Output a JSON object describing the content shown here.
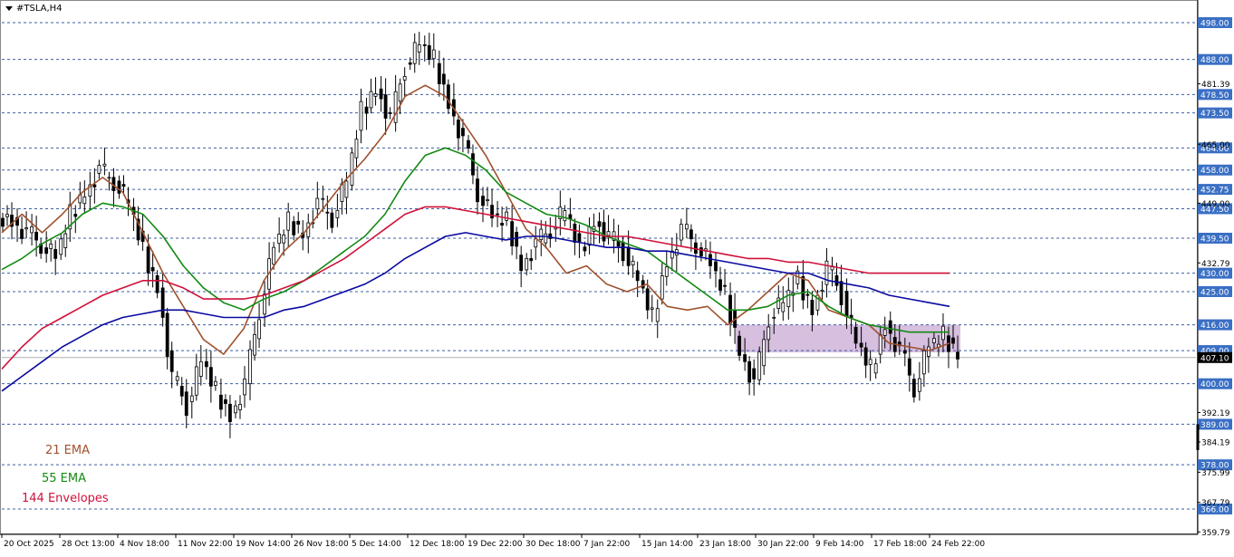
{
  "symbol": "#TSLA,H4",
  "legend": [
    {
      "label": "21 EMA",
      "color": "#a0522d"
    },
    {
      "label": "55 EMA",
      "color": "#138a13"
    },
    {
      "label": "144 Envelopes",
      "color": "#d0103a"
    }
  ],
  "colors": {
    "grid_level": "#3a5fa6",
    "price_badge": "#3a6fc4",
    "ema21": "#a0522d",
    "ema55": "#138a13",
    "env_upper": "#d0103a",
    "env_lower": "#0a0aa0",
    "zone": "#c9a9d4",
    "candle": "#000000",
    "current_price_badge": "#000000"
  },
  "chart_data": {
    "type": "candlestick",
    "symbol": "#TSLA",
    "timeframe": "H4",
    "ylim": [
      359.79,
      502
    ],
    "x_tick_labels": [
      "20 Oct 2025",
      "28 Oct 13:00",
      "4 Nov 18:00",
      "11 Nov 22:00",
      "19 Nov 14:00",
      "26 Nov 18:00",
      "5 Dec 14:00",
      "12 Dec 18:00",
      "19 Dec 22:00",
      "30 Dec 18:00",
      "7 Jan 22:00",
      "15 Jan 14:00",
      "23 Jan 18:00",
      "30 Jan 22:00",
      "9 Feb 14:00",
      "17 Feb 18:00",
      "24 Feb 22:00"
    ],
    "y_tick_labels": [
      481.39,
      465.0,
      449.0,
      432.79,
      392.19,
      384.19,
      375.99,
      367.79,
      359.79
    ],
    "horizontal_levels": [
      498.0,
      488.0,
      478.5,
      473.5,
      464.0,
      458.0,
      452.75,
      447.5,
      439.5,
      430.0,
      425.0,
      416.0,
      409.0,
      400.0,
      389.0,
      378.0,
      366.0
    ],
    "level_labels": [
      "498.00",
      "488.00",
      "478.50",
      "473.50",
      "464.00",
      "458.00",
      "452.75",
      "447.50",
      "439.50",
      "430.00",
      "425.00",
      "416.00",
      "409.00",
      "400.00",
      "389.00",
      "378.00",
      "366.00"
    ],
    "current_price": 407.1,
    "current_price_label": "407.10",
    "zone": {
      "from": 408.5,
      "to": 416.0,
      "start_date": "23 Jan 18:00",
      "end_date": "24 Feb 22:00"
    },
    "series": [
      {
        "name": "21 EMA",
        "values": [
          441,
          446,
          441,
          446,
          452,
          456,
          452,
          441,
          430,
          421,
          412,
          408,
          415,
          428,
          436,
          441,
          448,
          455,
          461,
          468,
          478,
          481,
          478,
          470,
          462,
          452,
          442,
          437,
          430,
          432,
          427,
          425,
          427,
          421,
          420,
          421,
          416,
          420,
          425,
          430,
          428,
          420,
          418,
          416,
          411,
          410,
          409,
          411
        ]
      },
      {
        "name": "55 EMA",
        "values": [
          431,
          434,
          438,
          441,
          446,
          449,
          448,
          446,
          440,
          432,
          426,
          422,
          420,
          423,
          425,
          428,
          432,
          436,
          440,
          446,
          455,
          462,
          464,
          462,
          458,
          452,
          449,
          446,
          445,
          443,
          440,
          438,
          436,
          432,
          428,
          424,
          420,
          420,
          421,
          424,
          425,
          421,
          418,
          416,
          415,
          414,
          414,
          414
        ]
      },
      {
        "name": "144 Envelopes upper",
        "values": [
          404,
          410,
          415,
          418,
          421,
          424,
          426,
          428,
          428,
          426,
          423,
          423,
          423,
          424,
          426,
          428,
          431,
          434,
          438,
          442,
          446,
          448,
          448,
          447,
          446,
          445,
          444,
          443,
          442,
          441,
          440,
          440,
          439,
          438,
          437,
          436,
          435,
          434,
          434,
          433,
          433,
          432,
          431,
          430,
          430,
          430,
          430,
          430
        ]
      },
      {
        "name": "144 Envelopes lower",
        "values": [
          398,
          402,
          406,
          410,
          413,
          416,
          418,
          419,
          420,
          420,
          419,
          418,
          418,
          418,
          420,
          421,
          423,
          425,
          427,
          430,
          434,
          437,
          440,
          441,
          440,
          439,
          440,
          440,
          439,
          438,
          437,
          437,
          436,
          436,
          435,
          434,
          433,
          432,
          431,
          430,
          430,
          428,
          427,
          426,
          424,
          423,
          422,
          421
        ]
      }
    ],
    "candles_close": [
      444,
      441,
      438,
      434,
      446,
      452,
      458,
      455,
      449,
      436,
      426,
      402,
      394,
      406,
      398,
      391,
      400,
      420,
      437,
      444,
      441,
      449,
      445,
      455,
      474,
      480,
      472,
      486,
      492,
      488,
      476,
      466,
      452,
      445,
      444,
      432,
      438,
      442,
      447,
      436,
      444,
      440,
      436,
      428,
      418,
      433,
      442,
      438,
      432,
      424,
      409,
      400,
      418,
      422,
      428,
      420,
      432,
      424,
      411,
      404,
      416,
      409,
      399,
      410,
      413,
      408
    ]
  }
}
